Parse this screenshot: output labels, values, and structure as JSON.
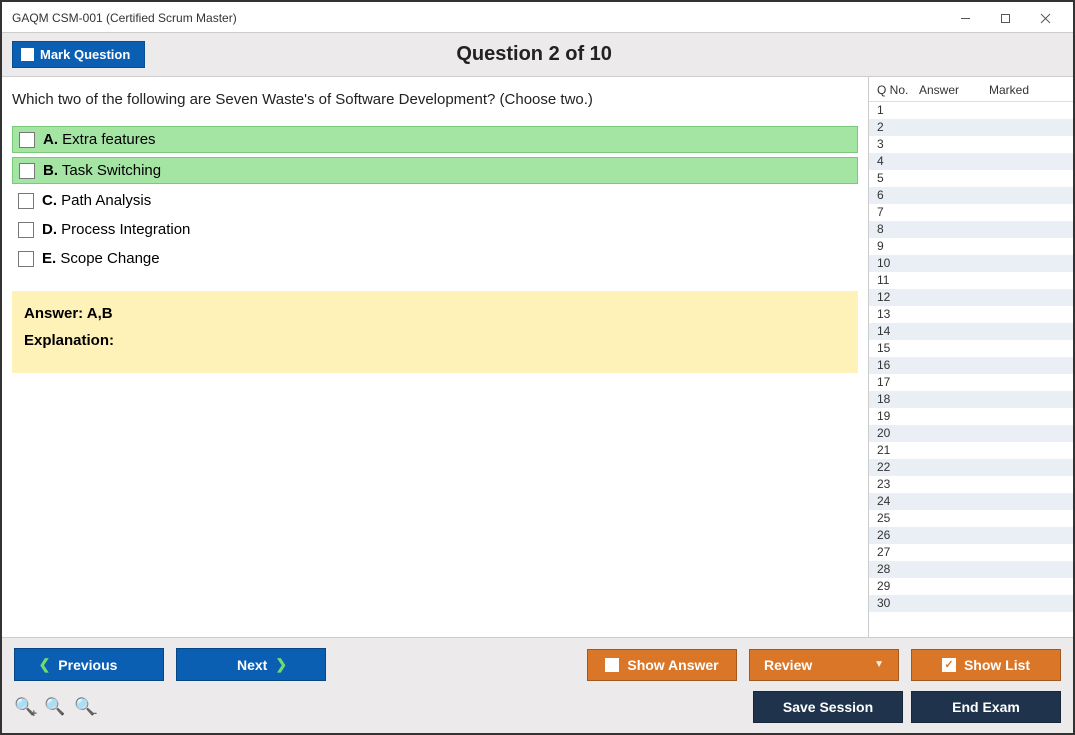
{
  "window": {
    "title": "GAQM CSM-001 (Certified Scrum Master)"
  },
  "header": {
    "mark_question": "Mark Question",
    "question_indicator": "Question 2 of 10"
  },
  "question": {
    "text": "Which two of the following are Seven Waste's of Software Development? (Choose two.)",
    "options": [
      {
        "letter": "A.",
        "text": "Extra features",
        "correct": true
      },
      {
        "letter": "B.",
        "text": "Task Switching",
        "correct": true
      },
      {
        "letter": "C.",
        "text": "Path Analysis",
        "correct": false
      },
      {
        "letter": "D.",
        "text": "Process Integration",
        "correct": false
      },
      {
        "letter": "E.",
        "text": "Scope Change",
        "correct": false
      }
    ],
    "answer_label": "Answer: A,B",
    "explanation_label": "Explanation:"
  },
  "side": {
    "headers": {
      "qno": "Q No.",
      "answer": "Answer",
      "marked": "Marked"
    },
    "rows_count": 30
  },
  "footer": {
    "previous": "Previous",
    "next": "Next",
    "show_answer": "Show Answer",
    "review": "Review",
    "show_list": "Show List",
    "save_session": "Save Session",
    "end_exam": "End Exam"
  }
}
